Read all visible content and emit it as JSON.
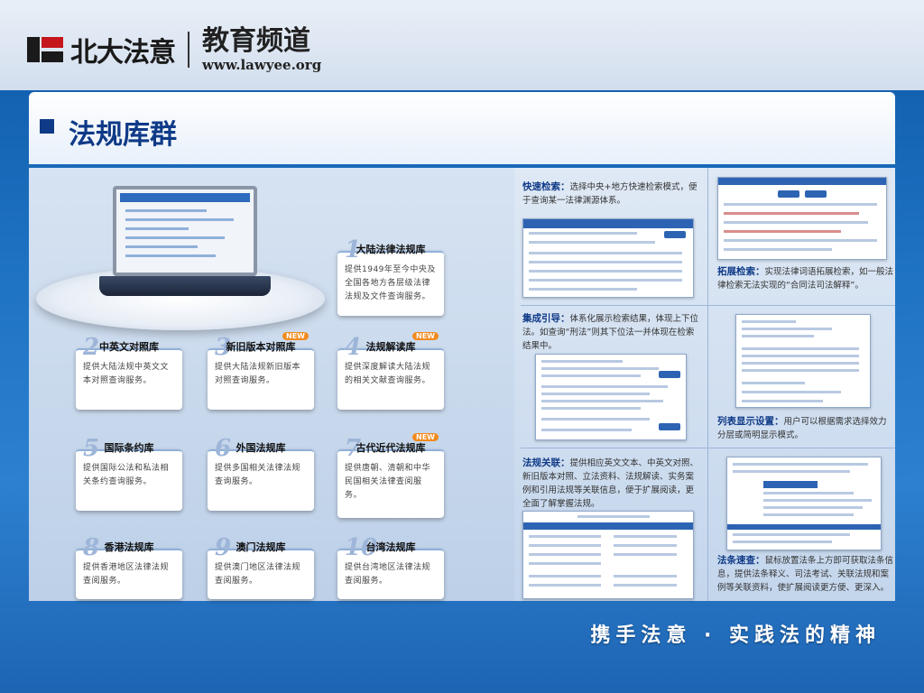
{
  "header": {
    "logo_text": "北大法意",
    "channel": "教育频道",
    "url": "www.lawyee.org"
  },
  "page_title": "法规库群",
  "cards": [
    {
      "num": "1",
      "name": "大陆法律法规库",
      "desc": "提供1949年至今中央及全国各地方各层级法律法规及文件查询服务。",
      "new": ""
    },
    {
      "num": "2",
      "name": "中英文对照库",
      "desc": "提供大陆法规中英文文本对照查询服务。",
      "new": ""
    },
    {
      "num": "3",
      "name": "新旧版本对照库",
      "desc": "提供大陆法规新旧版本对照查询服务。",
      "new": "NEW"
    },
    {
      "num": "4",
      "name": "法规解读库",
      "desc": "提供深度解读大陆法规的相关文献查询服务。",
      "new": "NEW"
    },
    {
      "num": "5",
      "name": "国际条约库",
      "desc": "提供国际公法和私法相关条约查询服务。",
      "new": ""
    },
    {
      "num": "6",
      "name": "外国法规库",
      "desc": "提供多国相关法律法规查询服务。",
      "new": ""
    },
    {
      "num": "7",
      "name": "古代近代法规库",
      "desc": "提供唐朝、清朝和中华民国相关法律查阅服务。",
      "new": "NEW"
    },
    {
      "num": "8",
      "name": "香港法规库",
      "desc": "提供香港地区法律法规查阅服务。",
      "new": ""
    },
    {
      "num": "9",
      "name": "澳门法规库",
      "desc": "提供澳门地区法律法规查阅服务。",
      "new": ""
    },
    {
      "num": "10",
      "name": "台湾法规库",
      "desc": "提供台湾地区法律法规查阅服务。",
      "new": ""
    }
  ],
  "features": {
    "quick_search": {
      "title": "快速检索：",
      "desc": "选择中央+地方快速检索模式，便于查询某一法律渊源体系。"
    },
    "extended_search": {
      "title": "拓展检索：",
      "desc": "实现法律词语拓展检索，如一般法律检索无法实现的“合同法司法解释”。"
    },
    "integrated_guide": {
      "title": "集成引导：",
      "desc": "体系化展示检索结果，体现上下位法。如查询“刑法”则其下位法一并体现在检索结果中。"
    },
    "list_display": {
      "title": "列表显示设置：",
      "desc": "用户可以根据需求选择效力分层或简明显示模式。"
    },
    "regulation_link": {
      "title": "法规关联：",
      "desc": "提供相应英文文本、中英文对照、新旧版本对照、立法资料、法规解读、实务案例和引用法规等关联信息，便于扩展阅读，更全面了解掌握法规。"
    },
    "clause_quick": {
      "title": "法条速查：",
      "desc": "鼠标放置法条上方即可获取法条信息，提供法条释义、司法考试、关联法规和案例等关联资料，使扩展阅读更方便、更深入。"
    }
  },
  "footer": {
    "slogan": "携手法意 · 实践法的精神"
  }
}
